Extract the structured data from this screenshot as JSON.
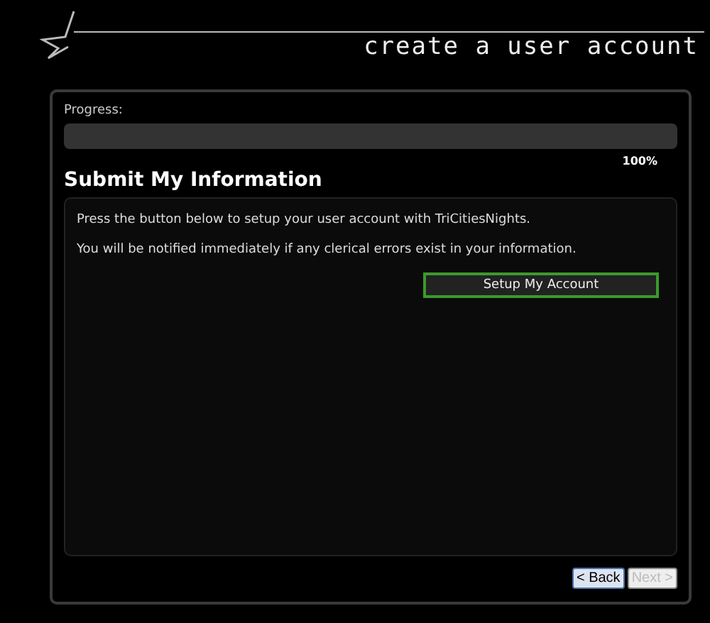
{
  "header": {
    "title": "create a user account"
  },
  "progress": {
    "label": "Progress:",
    "level": 1,
    "reading": "100%"
  },
  "section": {
    "title": "Submit My Information",
    "paragraphs": [
      "Press the button below to setup your user account with TriCitiesNights.",
      "You will be notified immediately if any clerical errors exist in your information."
    ],
    "action": "Setup My Account"
  },
  "nav": [
    {
      "label": "< Back",
      "disabled": false
    },
    {
      "label": "Next >",
      "disabled": true
    }
  ]
}
